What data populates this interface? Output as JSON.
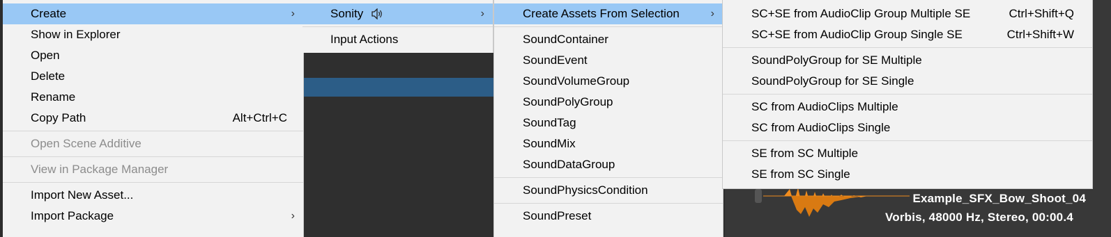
{
  "menu1": {
    "items": [
      {
        "label": "Create",
        "arrow": "›"
      },
      {
        "label": "Show in Explorer"
      },
      {
        "label": "Open"
      },
      {
        "label": "Delete"
      },
      {
        "label": "Rename"
      },
      {
        "label": "Copy Path",
        "shortcut": "Alt+Ctrl+C"
      },
      {
        "label": "Open Scene Additive"
      },
      {
        "label": "View in Package Manager"
      },
      {
        "label": "Import New Asset..."
      },
      {
        "label": "Import Package",
        "arrow": "›"
      }
    ]
  },
  "menu2": {
    "items": [
      {
        "label": "Sonity",
        "arrow": "›",
        "icon": "speaker-icon"
      },
      {
        "label": "Input Actions"
      }
    ]
  },
  "menu3": {
    "items": [
      {
        "label": "Create Assets From Selection",
        "arrow": "›"
      },
      {
        "label": "SoundContainer"
      },
      {
        "label": "SoundEvent"
      },
      {
        "label": "SoundVolumeGroup"
      },
      {
        "label": "SoundPolyGroup"
      },
      {
        "label": "SoundTag"
      },
      {
        "label": "SoundMix"
      },
      {
        "label": "SoundDataGroup"
      },
      {
        "label": "SoundPhysicsCondition"
      },
      {
        "label": "SoundPreset"
      }
    ]
  },
  "menu4": {
    "items": [
      {
        "label": "SC+SE from AudioClip Group Multiple SE",
        "shortcut": "Ctrl+Shift+Q"
      },
      {
        "label": "SC+SE from AudioClip Group Single SE",
        "shortcut": "Ctrl+Shift+W"
      },
      {
        "label": "SoundPolyGroup for SE Multiple"
      },
      {
        "label": "SoundPolyGroup for SE Single"
      },
      {
        "label": "SC from AudioClips Multiple"
      },
      {
        "label": "SC from AudioClips Single"
      },
      {
        "label": "SE from SC Multiple"
      },
      {
        "label": "SE from SC Single"
      }
    ]
  },
  "preview": {
    "clip_name": "Example_SFX_Bow_Shoot_04",
    "clip_info": "Vorbis, 48000 Hz, Stereo, 00:00.4"
  },
  "colors": {
    "highlight": "#99c8f5",
    "menu_bg": "#f2f2f2",
    "waveform": "#f08c1e",
    "selection_bg": "#2c5d87"
  }
}
